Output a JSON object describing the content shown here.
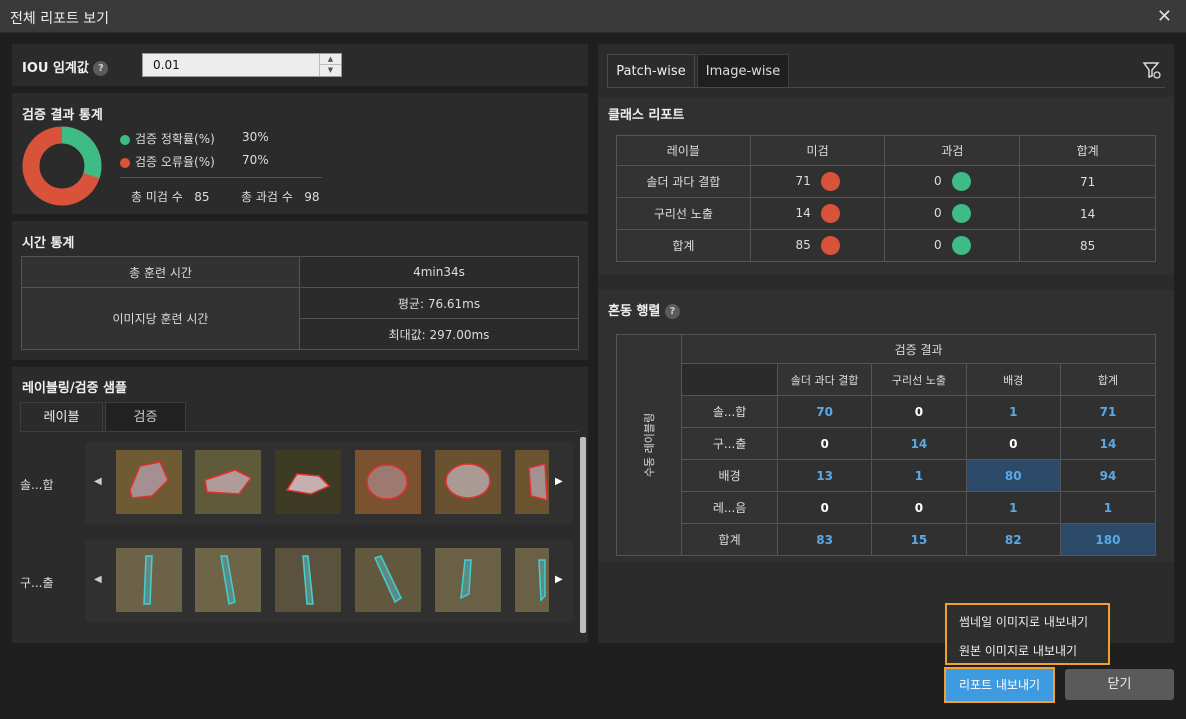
{
  "window": {
    "title": "전체 리포트 보기"
  },
  "iou": {
    "label": "IOU 임계값",
    "value": "0.01",
    "help": "?"
  },
  "stats": {
    "title": "검증 결과 통계",
    "accuracy_label": "검증 정확률(%)",
    "accuracy_value": "30%",
    "error_label": "검증 오류율(%)",
    "error_value": "70%",
    "miss_label": "총 미검 수",
    "miss_value": "85",
    "over_label": "총 과검 수",
    "over_value": "98",
    "accuracy_fraction": 0.3,
    "colors": {
      "accuracy": "#3fbb87",
      "error": "#d9533a"
    }
  },
  "time": {
    "title": "시간 통계",
    "total_label": "총 훈련 시간",
    "total_value": "4min34s",
    "per_image_label": "이미지당 훈련 시간",
    "avg": "평균: 76.61ms",
    "max": "최대값: 297.00ms"
  },
  "samples": {
    "title": "레이블링/검증 샘플",
    "tab_label": "레이블",
    "tab_verify": "검증",
    "rows": [
      {
        "label": "솔...합"
      },
      {
        "label": "구...출"
      }
    ]
  },
  "right_tabs": {
    "patch": "Patch-wise",
    "image": "Image-wise"
  },
  "class_report": {
    "title": "클래스 리포트",
    "headers": [
      "레이블",
      "미검",
      "과검",
      "합계"
    ],
    "rows": [
      {
        "label": "솔더 과다 결합",
        "miss": "71",
        "over": "0",
        "total": "71"
      },
      {
        "label": "구리선 노출",
        "miss": "14",
        "over": "0",
        "total": "14"
      },
      {
        "label": "합계",
        "miss": "85",
        "over": "0",
        "total": "85"
      }
    ]
  },
  "confusion": {
    "title": "혼동 행렬",
    "top_header": "검증 결과",
    "side_header": "수동 레이블링",
    "col_headers": [
      "솔더 과다 결합",
      "구리선 노출",
      "배경",
      "합계"
    ],
    "rows": [
      {
        "label": "솔...합",
        "values": [
          "70",
          "0",
          "1",
          "71"
        ]
      },
      {
        "label": "구...출",
        "values": [
          "0",
          "14",
          "0",
          "14"
        ]
      },
      {
        "label": "배경",
        "values": [
          "13",
          "1",
          "80",
          "94"
        ]
      },
      {
        "label": "레...음",
        "values": [
          "0",
          "0",
          "1",
          "1"
        ]
      },
      {
        "label": "합계",
        "values": [
          "83",
          "15",
          "82",
          "180"
        ]
      }
    ]
  },
  "export_menu": {
    "thumbnail": "썸네일 이미지로 내보내기",
    "original": "원본 이미지로 내보내기"
  },
  "buttons": {
    "export": "리포트 내보내기",
    "close": "닫기"
  }
}
